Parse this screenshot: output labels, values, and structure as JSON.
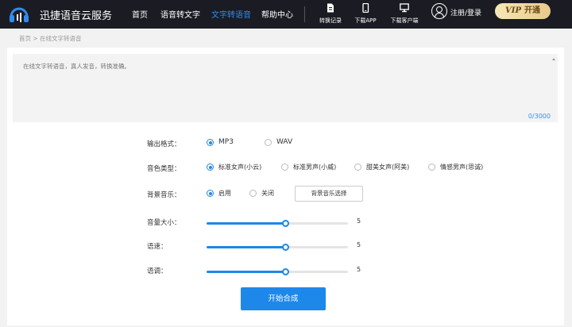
{
  "header": {
    "brand": "迅捷语音云服务",
    "nav": [
      "首页",
      "语音转文字",
      "文字转语音",
      "帮助中心"
    ],
    "active_nav": 2,
    "tools": [
      {
        "label": "转换记录",
        "icon": "document-icon"
      },
      {
        "label": "下载APP",
        "icon": "phone-icon"
      },
      {
        "label": "下载客户端",
        "icon": "monitor-icon"
      }
    ],
    "login_label": "注册/登录",
    "vip": {
      "badge": "VIP",
      "label": "开通"
    }
  },
  "breadcrumb": "首页 > 在线文字转语音",
  "editor": {
    "placeholder": "在线文字转语音，真人发音，转换准确。",
    "char_count": "0/3000"
  },
  "form": {
    "format": {
      "label": "输出格式：",
      "options": [
        "MP3",
        "WAV"
      ],
      "selected": 0
    },
    "voice": {
      "label": "音色类型：",
      "options": [
        "标准女声(小云)",
        "标准男声(小威)",
        "甜美女声(阿美)",
        "情感男声(思诚)"
      ],
      "selected": 0
    },
    "bg_music": {
      "label": "背景音乐：",
      "options": [
        "启用",
        "关闭"
      ],
      "selected": 0,
      "select_button": "背景音乐选择"
    },
    "volume": {
      "label": "音量大小：",
      "value": "5",
      "fraction": 0.56
    },
    "speed": {
      "label": "语速：",
      "value": "5",
      "fraction": 0.56
    },
    "pitch": {
      "label": "语调：",
      "value": "5",
      "fraction": 0.56
    }
  },
  "start_button": "开始合成",
  "colors": {
    "accent": "#1e88e5",
    "header_bg": "#1b1c23",
    "active_nav": "#2f8cf0"
  }
}
